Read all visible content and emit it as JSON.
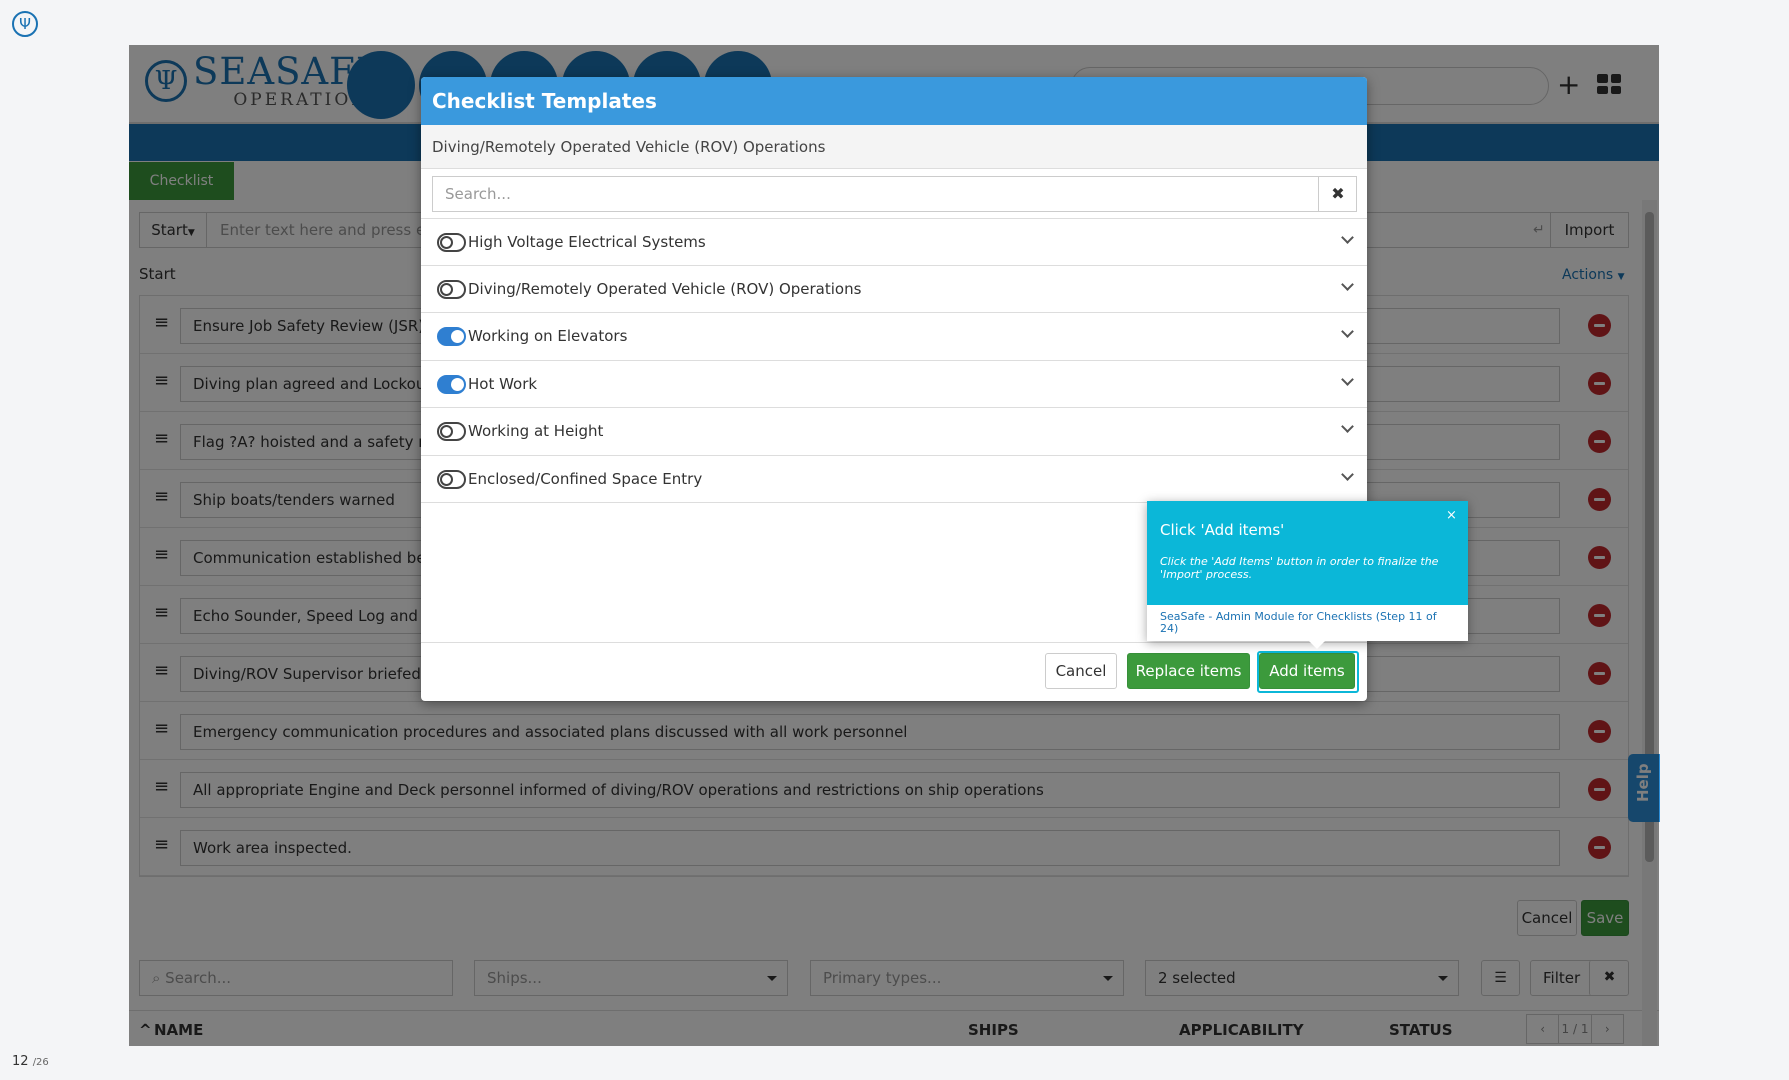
{
  "viewer": {
    "page_current": "12",
    "page_total": "/26"
  },
  "header": {
    "brand_name": "SEASAFE",
    "brand_sub": "OPERATIONS",
    "add_icon": "plus-icon",
    "apps_icon": "grid-icon"
  },
  "tab": {
    "label": "Checklist"
  },
  "editor": {
    "start_label": "Start",
    "input_placeholder": "Enter text here and press ent",
    "enter_icon": "↵",
    "import_label": "Import",
    "section_title": "Start",
    "actions_label": "Actions"
  },
  "items": [
    {
      "text": "Ensure Job Safety Review (JSR) is c"
    },
    {
      "text": "Diving plan agreed and Lockout T"
    },
    {
      "text": "Flag ?A? hoisted and a safety noti"
    },
    {
      "text": "Ship boats/tenders warned"
    },
    {
      "text": "Communication established betw"
    },
    {
      "text": "Echo Sounder, Speed Log and Cat"
    },
    {
      "text": "Diving/ROV Supervisor briefed on"
    },
    {
      "text": "Emergency communication procedures and associated plans discussed with all work personnel"
    },
    {
      "text": "All appropriate Engine and Deck personnel informed of diving/ROV operations and restrictions on ship operations"
    },
    {
      "text": "Work area inspected."
    }
  ],
  "editor_footer": {
    "cancel_label": "Cancel",
    "save_label": "Save"
  },
  "filters": {
    "search_placeholder": "Search...",
    "ships_placeholder": "Ships...",
    "primary_placeholder": "Primary types...",
    "selected_label": "2 selected",
    "filter_label": "Filter",
    "clear_label": "✖"
  },
  "list_head": {
    "name": "NAME",
    "ships": "SHIPS",
    "applicability": "APPLICABILITY",
    "status": "STATUS",
    "pager_prev": "‹",
    "pager_text": "1 / 1",
    "pager_next": "›"
  },
  "help_label": "Help",
  "modal": {
    "title": "Checklist Templates",
    "subtitle": "Diving/Remotely Operated Vehicle (ROV) Operations",
    "search_placeholder": "Search...",
    "clear_label": "✖",
    "templates": [
      {
        "label": "High Voltage Electrical Systems",
        "enabled": false
      },
      {
        "label": "Diving/Remotely Operated Vehicle (ROV) Operations",
        "enabled": false
      },
      {
        "label": "Working on Elevators",
        "enabled": true
      },
      {
        "label": "Hot Work",
        "enabled": true
      },
      {
        "label": "Working at Height",
        "enabled": false
      },
      {
        "label": "Enclosed/Confined Space Entry",
        "enabled": false
      }
    ],
    "cancel_label": "Cancel",
    "replace_label": "Replace items",
    "add_label": "Add items"
  },
  "tour": {
    "title": "Click 'Add items'",
    "text": "Click the 'Add Items' button in order to finalize the 'Import' process.",
    "close": "×",
    "link": "SeaSafe - Admin Module for Checklists (Step 11 of 24)"
  },
  "colors": {
    "brand_blue": "#1a72b3",
    "green": "#3c9a3c",
    "tour_cyan": "#0bb7d8",
    "danger": "#c0282d"
  }
}
